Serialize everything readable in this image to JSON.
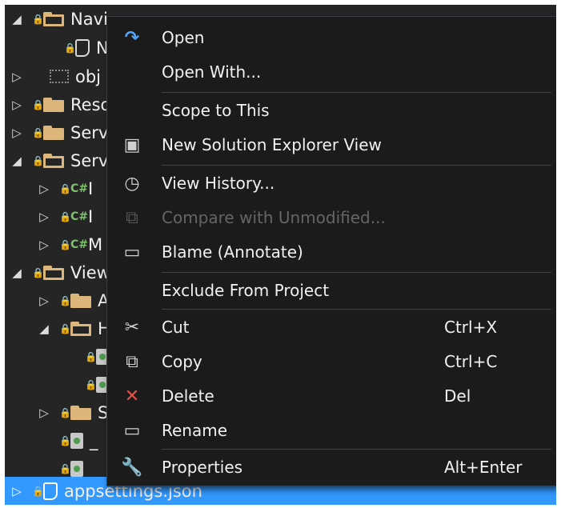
{
  "tree": {
    "rows": [
      {
        "twisty": "◢",
        "label": "Navi"
      },
      {
        "twisty": "",
        "label": "N"
      },
      {
        "twisty": "▷",
        "label": "obj"
      },
      {
        "twisty": "▷",
        "label": "Reso"
      },
      {
        "twisty": "▷",
        "label": "Serv"
      },
      {
        "twisty": "◢",
        "label": "Serv"
      },
      {
        "twisty": "▷",
        "label": "I"
      },
      {
        "twisty": "▷",
        "label": "I"
      },
      {
        "twisty": "▷",
        "label": "M"
      },
      {
        "twisty": "◢",
        "label": "View"
      },
      {
        "twisty": "▷",
        "label": "A"
      },
      {
        "twisty": "◢",
        "label": "H"
      },
      {
        "twisty": "",
        "label": ""
      },
      {
        "twisty": "",
        "label": ""
      },
      {
        "twisty": "▷",
        "label": "S"
      },
      {
        "twisty": "",
        "label": "_"
      },
      {
        "twisty": "",
        "label": "_"
      },
      {
        "twisty": "▷",
        "label": "appsettings.json"
      }
    ],
    "cs_badge": "C#",
    "lock_glyph": "🔒"
  },
  "menu": {
    "items": [
      {
        "label": "Open",
        "icon": "open-arrow-icon",
        "glyph": "↷",
        "shortcut": "",
        "enabled": true
      },
      {
        "label": "Open With...",
        "icon": "",
        "glyph": "",
        "shortcut": "",
        "enabled": true
      },
      {
        "label": "Scope to This",
        "icon": "",
        "glyph": "",
        "shortcut": "",
        "enabled": true
      },
      {
        "label": "New Solution Explorer View",
        "icon": "new-view-icon",
        "glyph": "▣",
        "shortcut": "",
        "enabled": true
      },
      {
        "label": "View History...",
        "icon": "history-icon",
        "glyph": "◷",
        "shortcut": "",
        "enabled": true
      },
      {
        "label": "Compare with Unmodified...",
        "icon": "compare-icon",
        "glyph": "⧉",
        "shortcut": "",
        "enabled": false
      },
      {
        "label": "Blame (Annotate)",
        "icon": "comment-icon",
        "glyph": "▭",
        "shortcut": "",
        "enabled": true
      },
      {
        "label": "Exclude From Project",
        "icon": "",
        "glyph": "",
        "shortcut": "",
        "enabled": true
      },
      {
        "label": "Cut",
        "icon": "scissors-icon",
        "glyph": "✂",
        "shortcut": "Ctrl+X",
        "enabled": true
      },
      {
        "label": "Copy",
        "icon": "copy-icon",
        "glyph": "⧉",
        "shortcut": "Ctrl+C",
        "enabled": true
      },
      {
        "label": "Delete",
        "icon": "delete-icon",
        "glyph": "✕",
        "shortcut": "Del",
        "enabled": true
      },
      {
        "label": "Rename",
        "icon": "rename-icon",
        "glyph": "▭",
        "shortcut": "",
        "enabled": true
      },
      {
        "label": "Properties",
        "icon": "wrench-icon",
        "glyph": "🔧",
        "shortcut": "Alt+Enter",
        "enabled": true
      }
    ]
  },
  "colors": {
    "background": "#252526",
    "menu_background": "#1b1b1c",
    "selection": "#3399ff",
    "open_icon": "#4fa7ff",
    "delete_icon": "#e8524a",
    "disabled_text": "#656565"
  }
}
